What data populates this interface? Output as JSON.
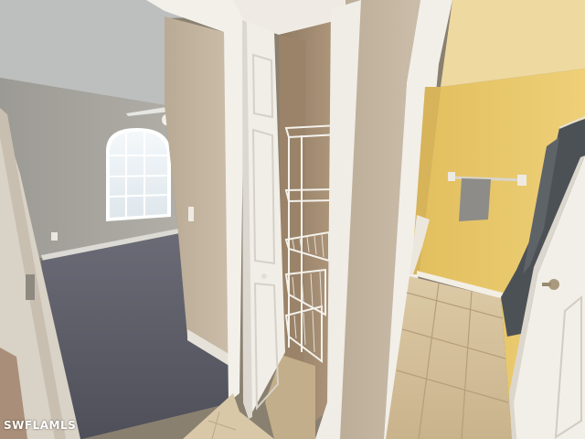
{
  "photo": {
    "watermark": "SWFLAMLS"
  },
  "colors": {
    "bedroom_wall": "#a7a59f",
    "ceiling": "#bcbfbe",
    "carpet": "#5d5f6a",
    "hallway_wall": "#c4b6a3",
    "door_white": "#efece6",
    "closet_interior": "#a38c72",
    "bathroom_wall": "#e8c86c",
    "tile_floor": "#d6c39f",
    "shower_curtain": "#4c5156",
    "towel": "#8d8c88"
  }
}
